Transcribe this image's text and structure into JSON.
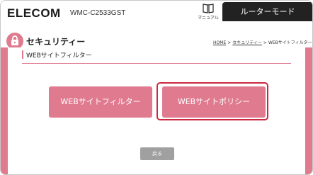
{
  "header": {
    "logo": "ELECOM",
    "model": "WMC-C2533GST",
    "manual_label": "マニュアル",
    "mode_tab": "ルーターモード"
  },
  "page": {
    "title": "セキュリティー",
    "breadcrumb": [
      "HOME",
      "セキュリティー",
      "WEBサイトフィルター"
    ],
    "breadcrumb_separator": ">"
  },
  "section": {
    "heading": "WEBサイトフィルター"
  },
  "buttons": {
    "filter_label": "WEBサイトフィルター",
    "policy_label": "WEBサイトポリシー",
    "back_label": "戻る"
  },
  "colors": {
    "accent": "#e07a8f",
    "highlight": "#cc2a40",
    "tab": "#222222",
    "back_button": "#a0a0a0"
  },
  "icons": {
    "manual": "book-icon",
    "section": "lock-icon"
  }
}
